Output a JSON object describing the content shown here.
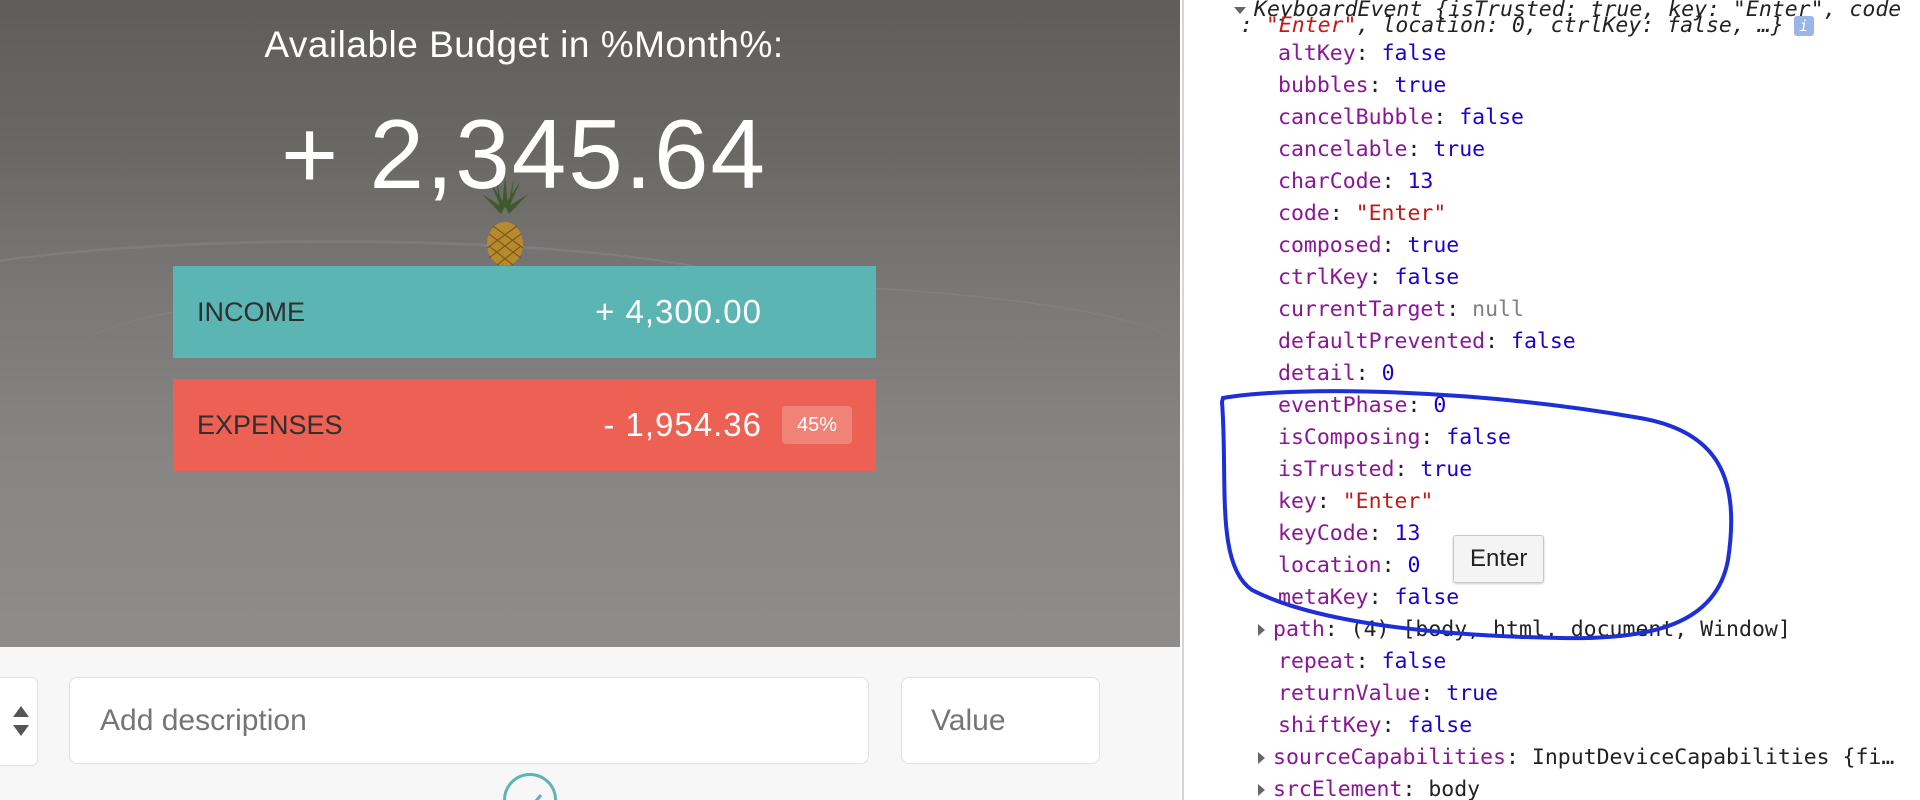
{
  "app": {
    "budget_title": "Available Budget in %Month%:",
    "budget_value": "+ 2,345.64",
    "income": {
      "label": "INCOME",
      "value": "+ 4,300.00"
    },
    "expenses": {
      "label": "EXPENSES",
      "value": "- 1,954.36",
      "percentage": "45%"
    },
    "add": {
      "description_placeholder": "Add description",
      "value_placeholder": "Value"
    },
    "colors": {
      "income": "#5bb5b3",
      "expenses": "#ec6153"
    }
  },
  "devtools": {
    "header_line1": "KeyboardEvent {isTrusted: true, key: \"Enter\", code",
    "header_line2_pre": ": ",
    "header_line2_str": "\"Enter\"",
    "header_line2_post": ", location: 0, ctrlKey: false, …}",
    "info_icon": "i",
    "properties": [
      {
        "key": "altKey",
        "value": "false",
        "type": "bool"
      },
      {
        "key": "bubbles",
        "value": "true",
        "type": "bool"
      },
      {
        "key": "cancelBubble",
        "value": "false",
        "type": "bool"
      },
      {
        "key": "cancelable",
        "value": "true",
        "type": "bool"
      },
      {
        "key": "charCode",
        "value": "13",
        "type": "num"
      },
      {
        "key": "code",
        "value": "\"Enter\"",
        "type": "str"
      },
      {
        "key": "composed",
        "value": "true",
        "type": "bool"
      },
      {
        "key": "ctrlKey",
        "value": "false",
        "type": "bool"
      },
      {
        "key": "currentTarget",
        "value": "null",
        "type": "nul"
      },
      {
        "key": "defaultPrevented",
        "value": "false",
        "type": "bool"
      },
      {
        "key": "detail",
        "value": "0",
        "type": "num"
      },
      {
        "key": "eventPhase",
        "value": "0",
        "type": "num"
      },
      {
        "key": "isComposing",
        "value": "false",
        "type": "bool"
      },
      {
        "key": "isTrusted",
        "value": "true",
        "type": "bool"
      },
      {
        "key": "key",
        "value": "\"Enter\"",
        "type": "str"
      },
      {
        "key": "keyCode",
        "value": "13",
        "type": "num"
      },
      {
        "key": "location",
        "value": "0",
        "type": "num"
      },
      {
        "key": "metaKey",
        "value": "false",
        "type": "bool"
      },
      {
        "key": "path",
        "value": "(4) [body, html, document, Window]",
        "type": "plain",
        "expandable": true
      },
      {
        "key": "repeat",
        "value": "false",
        "type": "bool"
      },
      {
        "key": "returnValue",
        "value": "true",
        "type": "bool"
      },
      {
        "key": "shiftKey",
        "value": "false",
        "type": "bool"
      },
      {
        "key": "sourceCapabilities",
        "value": "InputDeviceCapabilities {fi…",
        "type": "plain",
        "expandable": true
      },
      {
        "key": "srcElement",
        "value": "body",
        "type": "plain",
        "expandable": true
      }
    ],
    "tooltip": "Enter"
  }
}
